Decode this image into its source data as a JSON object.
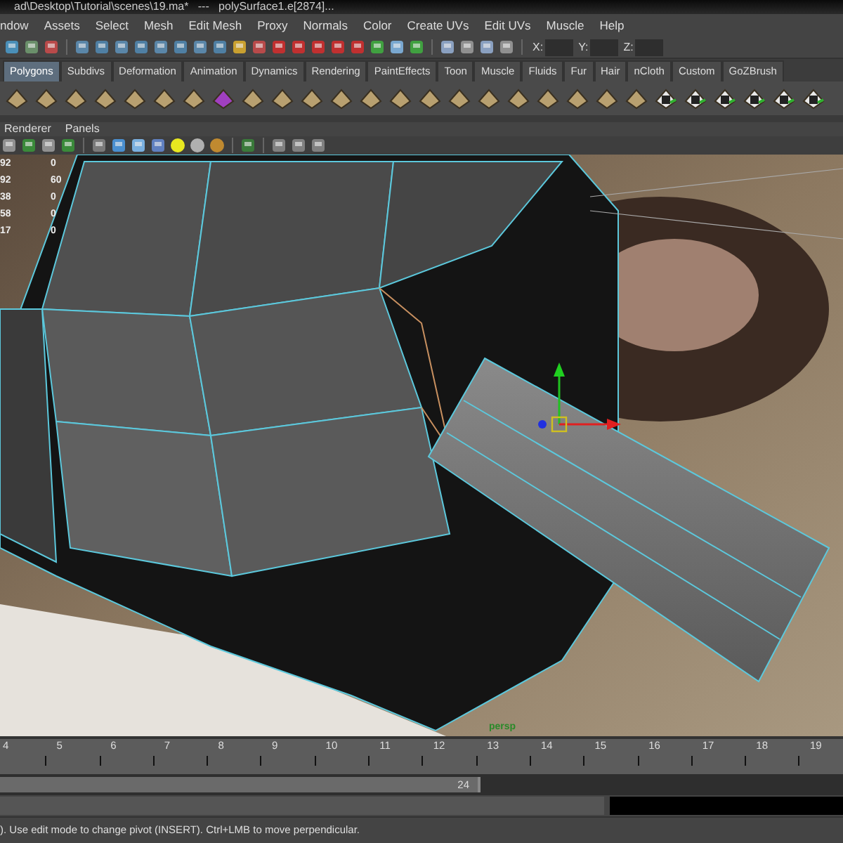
{
  "title_bar": {
    "text": "ad\\Desktop\\Tutorial\\scenes\\19.ma*   ---   polySurface1.e[2874]..."
  },
  "menu_bar": {
    "items": [
      "ndow",
      "Assets",
      "Select",
      "Mesh",
      "Edit Mesh",
      "Proxy",
      "Normals",
      "Color",
      "Create UVs",
      "Edit UVs",
      "Muscle",
      "Help"
    ]
  },
  "status_line": {
    "fields": [
      {
        "label": "X:"
      },
      {
        "label": "Y:"
      },
      {
        "label": "Z:"
      }
    ]
  },
  "shelf": {
    "tabs": [
      {
        "label": "Polygons",
        "selected": true
      },
      {
        "label": "Subdivs",
        "selected": false
      },
      {
        "label": "Deformation",
        "selected": false
      },
      {
        "label": "Animation",
        "selected": false
      },
      {
        "label": "Dynamics",
        "selected": false
      },
      {
        "label": "Rendering",
        "selected": false
      },
      {
        "label": "PaintEffects",
        "selected": false
      },
      {
        "label": "Toon",
        "selected": false
      },
      {
        "label": "Muscle",
        "selected": false
      },
      {
        "label": "Fluids",
        "selected": false
      },
      {
        "label": "Fur",
        "selected": false
      },
      {
        "label": "Hair",
        "selected": false
      },
      {
        "label": "nCloth",
        "selected": false
      },
      {
        "label": "Custom",
        "selected": false
      },
      {
        "label": "GoZBrush",
        "selected": false
      }
    ]
  },
  "panel_menu": {
    "items": [
      "Renderer",
      "Panels"
    ]
  },
  "viewport": {
    "hud_rows": [
      [
        "92",
        "0"
      ],
      [
        "92",
        "60"
      ],
      [
        "38",
        "0"
      ],
      [
        "58",
        "0"
      ],
      [
        "17",
        "0"
      ]
    ],
    "camera_label": "persp"
  },
  "time_slider": {
    "ticks": [
      "4",
      "5",
      "6",
      "7",
      "8",
      "9",
      "10",
      "11",
      "12",
      "13",
      "14",
      "15",
      "16",
      "17",
      "18",
      "19"
    ]
  },
  "range_slider": {
    "end_frame": "24",
    "level": 0.57
  },
  "help_line": {
    "text": "). Use edit mode to change pivot (INSERT).  Ctrl+LMB to move perpendicular."
  }
}
